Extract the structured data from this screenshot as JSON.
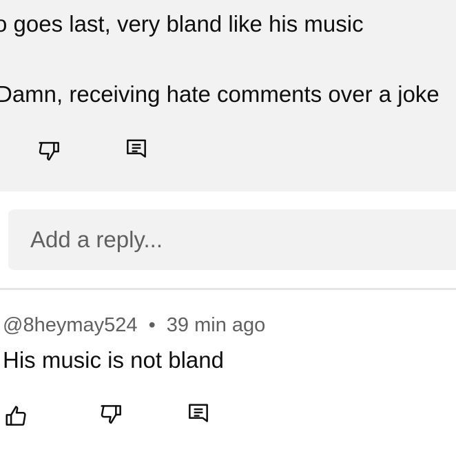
{
  "parent_comment": {
    "line1": "o goes last, very bland like his music",
    "line2": "Damn, receiving hate comments over a joke"
  },
  "reply_box": {
    "placeholder": "Add a reply..."
  },
  "comment": {
    "author": "@8heymay524",
    "separator": "•",
    "time": "39 min ago",
    "text": "His music is not bland"
  },
  "icons": {
    "dislike": "thumbs-down-icon",
    "reply": "reply-comment-icon",
    "like": "thumbs-up-icon"
  }
}
